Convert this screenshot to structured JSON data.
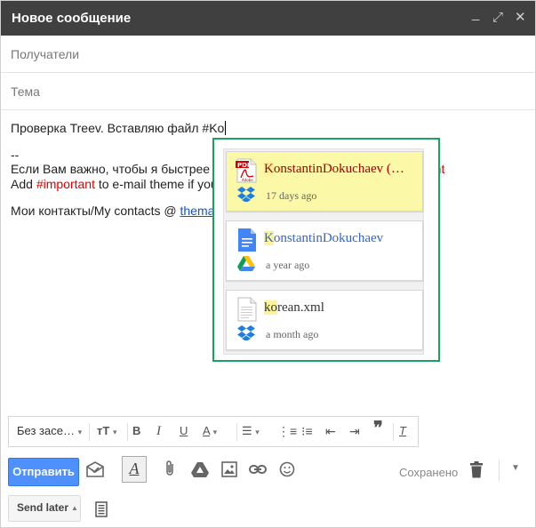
{
  "window": {
    "title": "Новое сообщение",
    "controls": [
      "_",
      "⤢",
      "✕"
    ]
  },
  "fields": {
    "recipients_placeholder": "Получатели",
    "subject_placeholder": "Тема"
  },
  "body": {
    "line1": "Проверка Treev. Вставляю файл #Ko",
    "line2": "--",
    "line3_start": "Если Вам важно, чтобы я быстрее от",
    "line3_red": "tant",
    "line4_start": "Add ",
    "line4_red": "#important",
    "line4_rest": " to e-mail theme if you r",
    "line5_start": "Мои контакты/My contacts @ ",
    "line5_link": "themarfa"
  },
  "suggestions": [
    {
      "name_hl": "K",
      "name_rest": "onstantinDokuchaev (…",
      "meta": "17 days ago",
      "file_icon": "pdf-file-icon",
      "source_icon": "dropbox-icon",
      "name_color": "#a80000",
      "selected": true
    },
    {
      "name_hl": "K",
      "name_rest": "onstantinDokuchaev",
      "meta": "a year ago",
      "file_icon": "google-doc-icon",
      "source_icon": "google-drive-icon",
      "name_color": "#3366cc",
      "selected": false
    },
    {
      "name_hl": "ko",
      "name_rest": "rean.xml",
      "meta": "a month ago",
      "file_icon": "generic-file-icon",
      "source_icon": "dropbox-icon",
      "name_color": "#333333",
      "selected": false
    }
  ],
  "format_toolbar": {
    "font_label": "Без засе…",
    "bold": "B",
    "italic": "I",
    "underline": "U",
    "text_color": "A",
    "clear_format": "T"
  },
  "bottom_bar": {
    "send_label": "Отправить",
    "saved_label": "Сохранено",
    "send_later_label": "Send later"
  },
  "colors": {
    "send_button": "#4d90fe",
    "popup_border": "#1aa260",
    "selected_card": "#fbf8a8",
    "title_bar": "#404040"
  }
}
